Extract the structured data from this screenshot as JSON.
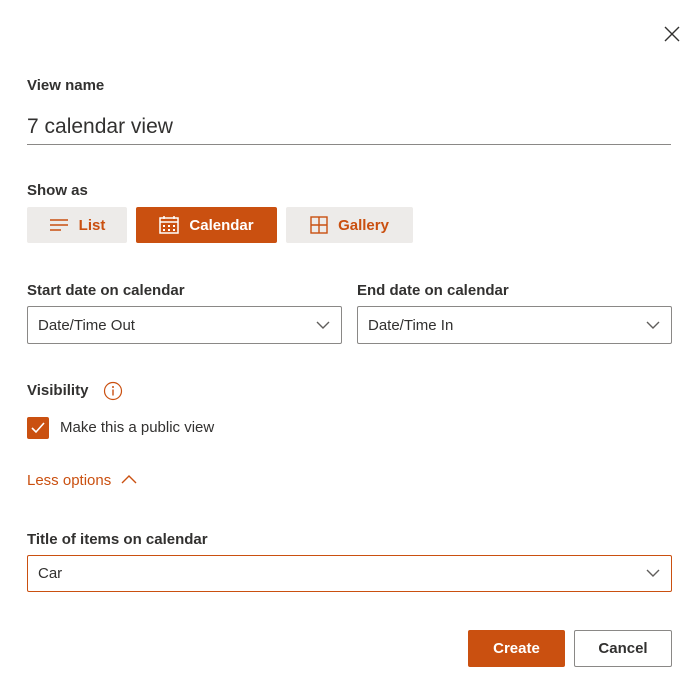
{
  "dialog": {
    "close_icon": "close-icon",
    "view_name": {
      "label": "View name",
      "value": "7 calendar view"
    },
    "show_as": {
      "label": "Show as",
      "options": [
        {
          "label": "List",
          "icon": "list-icon",
          "selected": false
        },
        {
          "label": "Calendar",
          "icon": "calendar-icon",
          "selected": true
        },
        {
          "label": "Gallery",
          "icon": "gallery-icon",
          "selected": false
        }
      ]
    },
    "start_date": {
      "label": "Start date on calendar",
      "value": "Date/Time Out"
    },
    "end_date": {
      "label": "End date on calendar",
      "value": "Date/Time In"
    },
    "visibility": {
      "label": "Visibility",
      "info_icon": "info-icon",
      "public_checkbox": {
        "label": "Make this a public view",
        "checked": true
      }
    },
    "less_options": {
      "label": "Less options",
      "icon": "chevron-up-icon"
    },
    "title_items": {
      "label": "Title of items on calendar",
      "value": "Car"
    },
    "buttons": {
      "create": "Create",
      "cancel": "Cancel"
    }
  },
  "colors": {
    "accent": "#ca5010",
    "neutral_bg": "#edebe9",
    "text": "#323130",
    "border": "#8a8886"
  }
}
